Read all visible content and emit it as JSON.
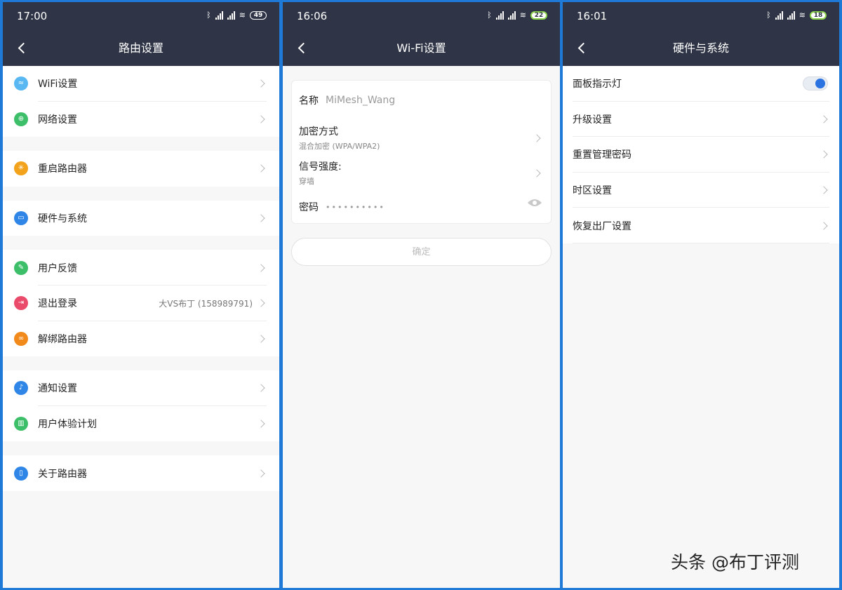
{
  "screen1": {
    "time": "17:00",
    "battery": "49",
    "title": "路由设置",
    "groups": [
      [
        {
          "label": "WiFi设置",
          "icon": "wifi-icon",
          "color": "#59b8f2",
          "glyph": "≈"
        },
        {
          "label": "网络设置",
          "icon": "globe-icon",
          "color": "#3dbf6a",
          "glyph": "⊕"
        }
      ],
      [
        {
          "label": "重启路由器",
          "icon": "restart-icon",
          "color": "#f2a21b",
          "glyph": "✳"
        }
      ],
      [
        {
          "label": "硬件与系统",
          "icon": "router-icon",
          "color": "#2f86e6",
          "glyph": "▭"
        }
      ],
      [
        {
          "label": "用户反馈",
          "icon": "feedback-icon",
          "color": "#3dbf6a",
          "glyph": "✎"
        },
        {
          "label": "退出登录",
          "icon": "logout-icon",
          "color": "#ea4b6a",
          "glyph": "⇥",
          "detail": "大VS布丁 (158989791)"
        },
        {
          "label": "解绑路由器",
          "icon": "unlink-icon",
          "color": "#f28a1b",
          "glyph": "∞"
        }
      ],
      [
        {
          "label": "通知设置",
          "icon": "bell-icon",
          "color": "#2f86e6",
          "glyph": "♪"
        },
        {
          "label": "用户体验计划",
          "icon": "chart-icon",
          "color": "#3dbf6a",
          "glyph": "▥"
        }
      ],
      [
        {
          "label": "关于路由器",
          "icon": "book-icon",
          "color": "#2f86e6",
          "glyph": "▯"
        }
      ]
    ]
  },
  "screen2": {
    "time": "16:06",
    "battery": "22",
    "title": "Wi-Fi设置",
    "name_label": "名称",
    "name_value": "MiMesh_Wang",
    "enc_label": "加密方式",
    "enc_value": "混合加密 (WPA/WPA2)",
    "signal_label": "信号强度:",
    "signal_value": "穿墙",
    "pwd_label": "密码",
    "pwd_value": "••••••••••",
    "confirm": "确定"
  },
  "screen3": {
    "time": "16:01",
    "battery": "18",
    "title": "硬件与系统",
    "items": [
      {
        "label": "面板指示灯",
        "type": "toggle",
        "on": true
      },
      {
        "label": "升级设置",
        "type": "link"
      },
      {
        "label": "重置管理密码",
        "type": "link"
      },
      {
        "label": "时区设置",
        "type": "link"
      },
      {
        "label": "恢复出厂设置",
        "type": "link"
      }
    ]
  },
  "watermark": "头条 @布丁评测",
  "colors": {
    "header": "#2f3546",
    "accent": "#2a73e0",
    "border": "#1e7ad6"
  }
}
